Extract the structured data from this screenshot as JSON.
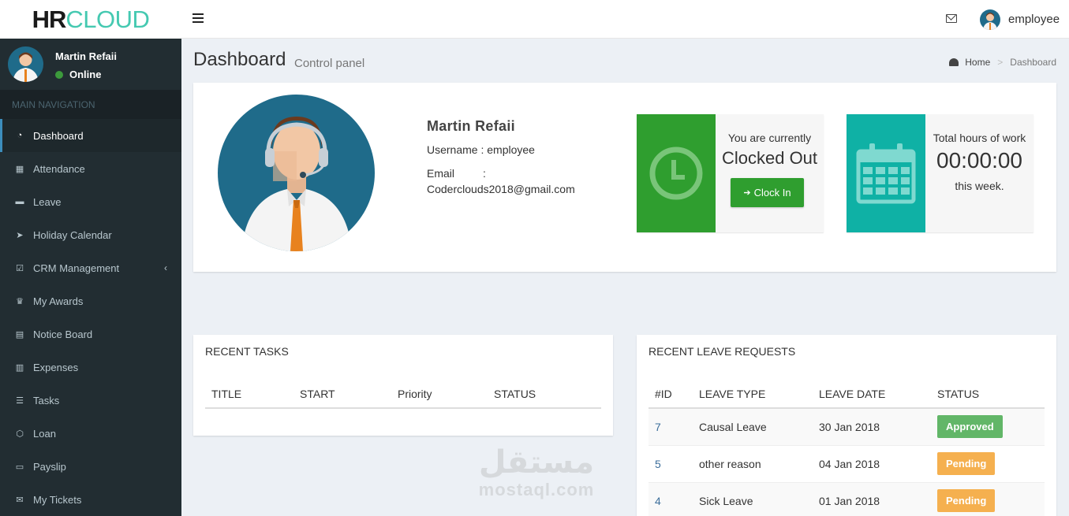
{
  "logo": {
    "part1": "HR",
    "part2": "CLOUD"
  },
  "topbar": {
    "username": "employee"
  },
  "sidebar": {
    "user_name": "Martin Refaii",
    "status": "Online",
    "nav_header": "MAIN NAVIGATION",
    "items": [
      {
        "label": "Dashboard",
        "icon": "dashboard-icon",
        "glyph": "◔"
      },
      {
        "label": "Attendance",
        "icon": "calendar-icon",
        "glyph": "▦"
      },
      {
        "label": "Leave",
        "icon": "bed-icon",
        "glyph": "▬"
      },
      {
        "label": "Holiday Calendar",
        "icon": "paper-plane-icon",
        "glyph": "➤"
      },
      {
        "label": "CRM Management",
        "icon": "calendar-check-icon",
        "glyph": "☑"
      },
      {
        "label": "My Awards",
        "icon": "trophy-icon",
        "glyph": "♛"
      },
      {
        "label": "Notice Board",
        "icon": "sticky-note-icon",
        "glyph": "▤"
      },
      {
        "label": "Expenses",
        "icon": "bar-chart-icon",
        "glyph": "▥"
      },
      {
        "label": "Tasks",
        "icon": "list-icon",
        "glyph": "☰"
      },
      {
        "label": "Loan",
        "icon": "cube-icon",
        "glyph": "⬡"
      },
      {
        "label": "Payslip",
        "icon": "print-icon",
        "glyph": "▭"
      },
      {
        "label": "My Tickets",
        "icon": "envelope-icon",
        "glyph": "✉"
      }
    ],
    "crm_chevron": "‹"
  },
  "header": {
    "title": "Dashboard",
    "subtitle": "Control panel",
    "breadcrumb_home": "Home",
    "breadcrumb_sep": ">",
    "breadcrumb_current": "Dashboard"
  },
  "profile": {
    "name": "Martin Refaii",
    "username_line": "Username : employee",
    "email_label": "Email",
    "email_colon": ":",
    "email": "Coderclouds2018@gmail.com"
  },
  "clock_box": {
    "line1": "You are currently",
    "state": "Clocked Out",
    "button_label": "Clock In",
    "color": "#2f9e2f"
  },
  "hours_box": {
    "line1": "Total hours of work",
    "value": "00:00:00",
    "line3": "this week.",
    "color": "#0fb1a5"
  },
  "recent_tasks": {
    "title": "RECENT TASKS",
    "columns": [
      "TITLE",
      "START",
      "Priority",
      "STATUS"
    ]
  },
  "recent_leave": {
    "title": "RECENT LEAVE REQUESTS",
    "columns": [
      "#ID",
      "LEAVE TYPE",
      "LEAVE DATE",
      "STATUS"
    ],
    "rows": [
      {
        "id": "7",
        "type": "Causal Leave",
        "date": "30 Jan 2018",
        "status": "Approved"
      },
      {
        "id": "5",
        "type": "other reason",
        "date": "04 Jan 2018",
        "status": "Pending"
      },
      {
        "id": "4",
        "type": "Sick Leave",
        "date": "01 Jan 2018",
        "status": "Pending"
      }
    ]
  },
  "watermark": {
    "arabic": "مستقل",
    "latin": "mostaql.com"
  }
}
